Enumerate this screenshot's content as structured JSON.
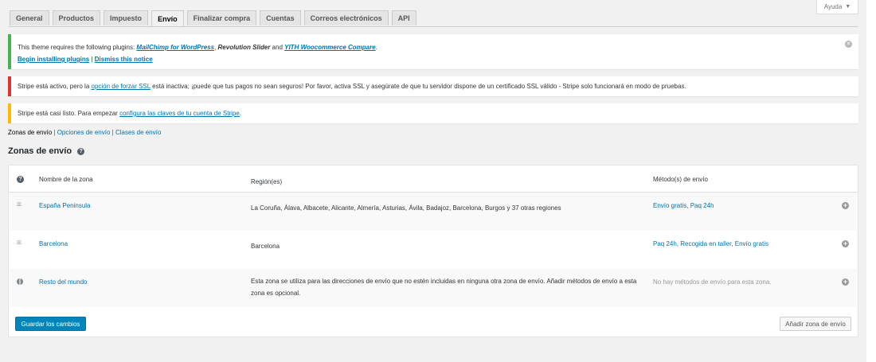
{
  "help": {
    "label": "Ayuda",
    "caret": "▼"
  },
  "tabs": [
    {
      "label": "General"
    },
    {
      "label": "Productos"
    },
    {
      "label": "Impuesto"
    },
    {
      "label": "Envío",
      "active": true
    },
    {
      "label": "Finalizar compra"
    },
    {
      "label": "Cuentas"
    },
    {
      "label": "Correos electrónicos"
    },
    {
      "label": "API"
    }
  ],
  "notices": {
    "plugins": {
      "text1": "This theme requires the following plugins: ",
      "plugin1": "MailChimp for WordPress",
      "sep1": ", ",
      "plugin2": "Revolution Slider",
      "and": " and ",
      "plugin3": "YITH Woocommerce Compare",
      "period": ".",
      "begin_link": "Begin installing plugins",
      "bar": " | ",
      "dismiss_link": "Dismiss this notice",
      "close": "✕"
    },
    "ssl": {
      "before": "Stripe está activo, pero la ",
      "link": "opción de forzar SSL",
      "after": " está inactiva; ¡puede que tus pagos no sean seguros! Por favor, activa SSL y asegúrate de que tu servidor dispone de un certificado SSL válido - Stripe solo funcionará en modo de pruebas."
    },
    "stripe": {
      "before": "Stripe está casi listo. Para empezar ",
      "link": "configura las claves de tu cuenta de Stripe",
      "after": "."
    }
  },
  "subnav": {
    "zones": "Zonas de envío",
    "sep1": " | ",
    "options": "Opciones de envío",
    "sep2": " | ",
    "classes": "Clases de envío"
  },
  "heading": {
    "title": "Zonas de envío",
    "help": "?"
  },
  "table": {
    "header_icon": "?",
    "columns": {
      "name": "Nombre de la zona",
      "region": "Región(es)",
      "methods": "Método(s) de envío"
    },
    "rows": [
      {
        "icon": "≡",
        "name": "España Peninsula",
        "region": "La Coruña, Álava, Albacete, Alicante, Almería, Asturias, Ávila, Badajoz, Barcelona, Burgos y 37 otras regiones",
        "methods": "Envío gratis, Paq 24h"
      },
      {
        "icon": "≡",
        "name": "Barcelona",
        "region": "Barcelona",
        "methods": "Paq 24h, Recogida en taller, Envío gratis"
      },
      {
        "icon": "globe",
        "name": "Resto del mundo",
        "region": "Esta zona se utiliza para las direcciones de envío que no estén incluidas en ninguna otra zona de envío. Añadir métodos de envío a esta zona es opcional.",
        "methods": "No hay métodos de envío para esta zona."
      }
    ],
    "add_icon": "+",
    "save_label": "Guardar los cambios",
    "add_zone_label": "Añadir zona de envío"
  }
}
